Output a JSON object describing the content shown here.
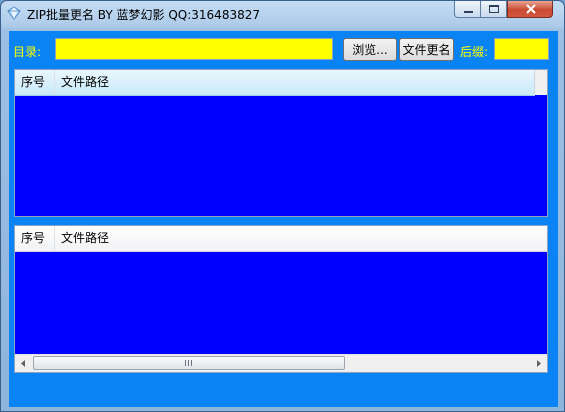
{
  "window": {
    "title": "ZIP批量更名 BY 蓝梦幻影 QQ:316483827"
  },
  "toolbar": {
    "dir_label": "目录:",
    "dir_value": "",
    "browse_label": "浏览...",
    "rename_label": "文件更名",
    "suffix_label": "后缀:",
    "suffix_value": ""
  },
  "list_top": {
    "columns": [
      "序号",
      "文件路径"
    ],
    "rows": []
  },
  "list_bottom": {
    "columns": [
      "序号",
      "文件路径"
    ],
    "rows": []
  },
  "icons": {
    "app": "gem-icon",
    "minimize": "minimize-icon",
    "maximize": "maximize-icon",
    "close": "close-icon"
  },
  "colors": {
    "client_bg": "#0a84f5",
    "list_bg": "#0000ff",
    "input_bg": "#ffff00",
    "label_color": "#ffff00"
  }
}
